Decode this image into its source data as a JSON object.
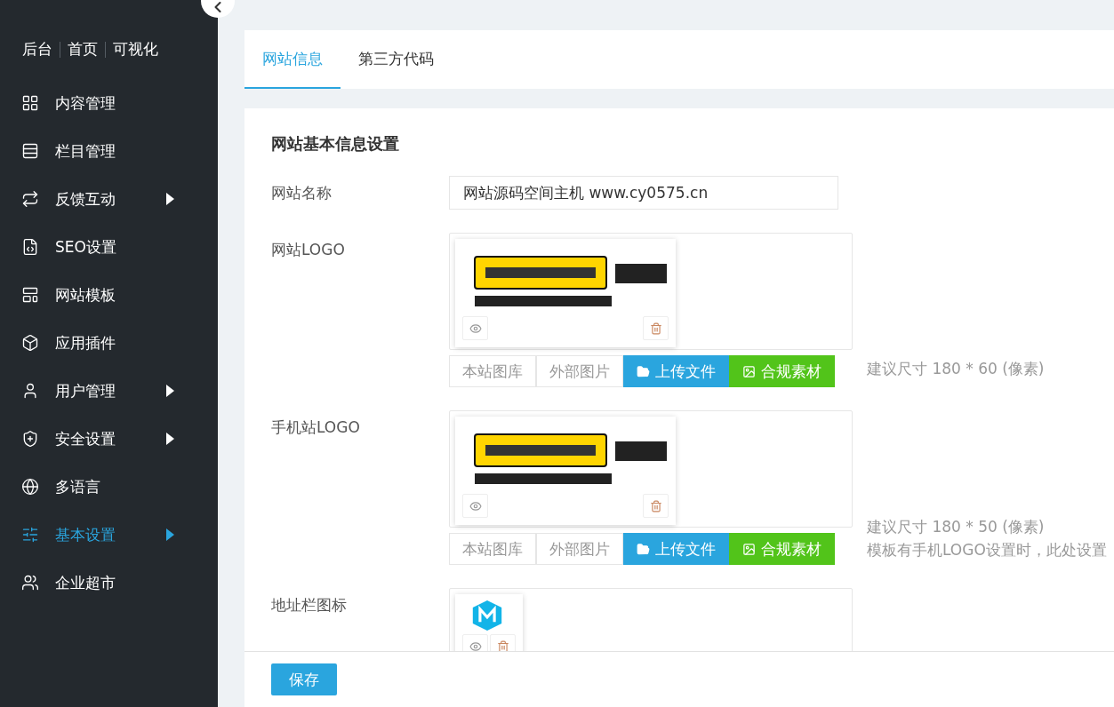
{
  "sidebar": {
    "quick_links": [
      "后台",
      "首页",
      "可视化"
    ],
    "menu": [
      {
        "label": "内容管理",
        "expandable": false,
        "selected": false
      },
      {
        "label": "栏目管理",
        "expandable": false,
        "selected": false
      },
      {
        "label": "反馈互动",
        "expandable": true,
        "selected": false
      },
      {
        "label": "SEO设置",
        "expandable": false,
        "selected": false
      },
      {
        "label": "网站模板",
        "expandable": false,
        "selected": false
      },
      {
        "label": "应用插件",
        "expandable": false,
        "selected": false
      },
      {
        "label": "用户管理",
        "expandable": true,
        "selected": false
      },
      {
        "label": "安全设置",
        "expandable": true,
        "selected": false
      },
      {
        "label": "多语言",
        "expandable": false,
        "selected": false
      },
      {
        "label": "基本设置",
        "expandable": true,
        "selected": true
      },
      {
        "label": "企业超市",
        "expandable": false,
        "selected": false
      }
    ]
  },
  "tabs": [
    {
      "label": "网站信息",
      "selected": true
    },
    {
      "label": "第三方代码",
      "selected": false
    }
  ],
  "section_title": "网站基本信息设置",
  "fields": [
    {
      "kind": "text",
      "label": "网站名称",
      "value": "网站源码空间主机 www.cy0575.cn"
    },
    {
      "kind": "logo",
      "label": "网站LOGO",
      "actions": [
        {
          "kind": "plain",
          "label": "本站图库"
        },
        {
          "kind": "plain",
          "label": "外部图片"
        },
        {
          "kind": "upload",
          "label": "上传文件"
        },
        {
          "kind": "material",
          "label": "合规素材"
        }
      ],
      "hints": [
        "建议尺寸 180 * 60 (像素)"
      ]
    },
    {
      "kind": "logo",
      "label": "手机站LOGO",
      "actions": [
        {
          "kind": "plain",
          "label": "本站图库"
        },
        {
          "kind": "plain",
          "label": "外部图片"
        },
        {
          "kind": "upload",
          "label": "上传文件"
        },
        {
          "kind": "material",
          "label": "合规素材"
        }
      ],
      "hints": [
        "建议尺寸 180 * 50 (像素)",
        "模板有手机LOGO设置时，此处设置"
      ]
    },
    {
      "kind": "favicon",
      "label": "地址栏图标"
    }
  ],
  "save_button": "保存"
}
